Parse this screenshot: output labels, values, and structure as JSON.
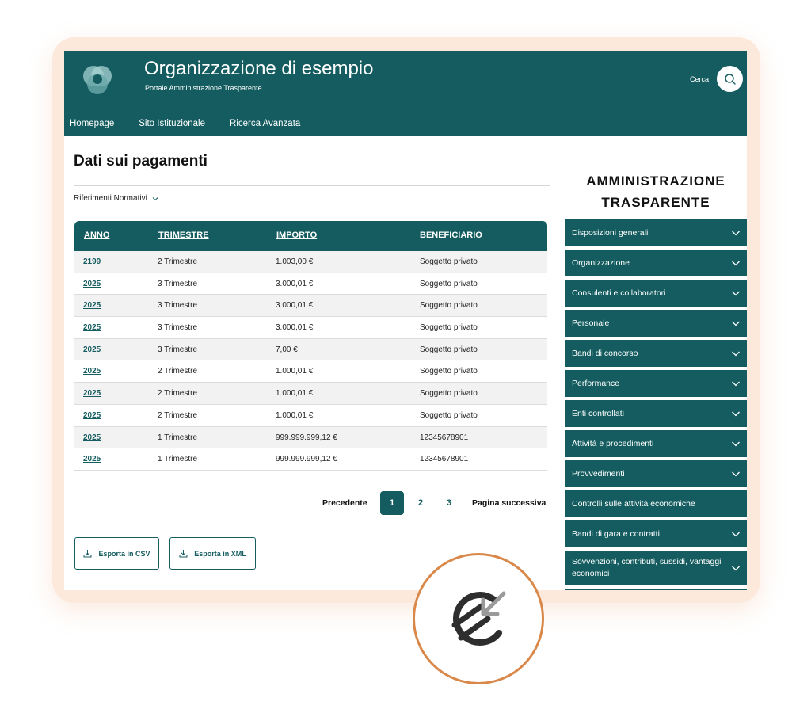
{
  "header": {
    "title": "Organizzazione di esempio",
    "subtitle": "Portale Amministrazione Trasparente",
    "search_label": "Cerca"
  },
  "nav": {
    "items": [
      "Homepage",
      "Sito Istituzionale",
      "Ricerca Avanzata"
    ]
  },
  "main": {
    "page_title": "Dati sui pagamenti",
    "references_label": "Riferimenti Normativi",
    "table": {
      "headers": [
        "ANNO",
        "TRIMESTRE",
        "IMPORTO",
        "BENEFICIARIO"
      ],
      "rows": [
        [
          "2199",
          "2 Trimestre",
          "1.003,00 €",
          "Soggetto privato"
        ],
        [
          "2025",
          "3 Trimestre",
          "3.000,01 €",
          "Soggetto privato"
        ],
        [
          "2025",
          "3 Trimestre",
          "3.000,01 €",
          "Soggetto privato"
        ],
        [
          "2025",
          "3 Trimestre",
          "3.000,01 €",
          "Soggetto privato"
        ],
        [
          "2025",
          "3 Trimestre",
          "7,00 €",
          "Soggetto privato"
        ],
        [
          "2025",
          "2 Trimestre",
          "1.000,01 €",
          "Soggetto privato"
        ],
        [
          "2025",
          "2 Trimestre",
          "1.000,01 €",
          "Soggetto privato"
        ],
        [
          "2025",
          "2 Trimestre",
          "1.000,01 €",
          "Soggetto privato"
        ],
        [
          "2025",
          "1 Trimestre",
          "999.999.999,12 €",
          "12345678901"
        ],
        [
          "2025",
          "1 Trimestre",
          "999.999.999,12 €",
          "12345678901"
        ]
      ]
    },
    "pagination": {
      "prev_label": "Precedente",
      "pages": [
        "1",
        "2",
        "3"
      ],
      "active_page": "1",
      "next_label": "Pagina successiva"
    },
    "export": {
      "csv_label": "Esporta in CSV",
      "xml_label": "Esporta in XML"
    }
  },
  "sidebar": {
    "title_line1": "AMMINISTRAZIONE",
    "title_line2": "TRASPARENTE",
    "items": [
      {
        "label": "Disposizioni generali",
        "expandable": true
      },
      {
        "label": "Organizzazione",
        "expandable": true
      },
      {
        "label": "Consulenti e collaboratori",
        "expandable": true
      },
      {
        "label": "Personale",
        "expandable": true
      },
      {
        "label": "Bandi di concorso",
        "expandable": true
      },
      {
        "label": "Performance",
        "expandable": true
      },
      {
        "label": "Enti controllati",
        "expandable": true
      },
      {
        "label": "Attività  e procedimenti",
        "expandable": true
      },
      {
        "label": "Provvedimenti",
        "expandable": true
      },
      {
        "label": "Controlli sulle attività economiche",
        "expandable": false
      },
      {
        "label": "Bandi di gara e contratti",
        "expandable": true
      },
      {
        "label": "Sovvenzioni, contributi, sussidi, vantaggi economici",
        "expandable": true
      }
    ]
  },
  "colors": {
    "brand": "#145c5f",
    "frame": "#fde9dc",
    "badge_ring": "#d9884a"
  },
  "icons": {
    "logo": "overlapping-rings-logo",
    "search": "search-icon",
    "download": "download-icon",
    "chevron": "chevron-down-icon",
    "badge": "euro-return-icon"
  }
}
